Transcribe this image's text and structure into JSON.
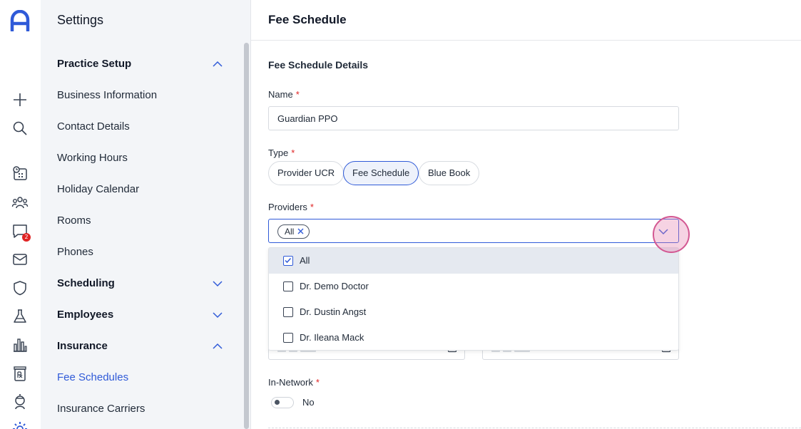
{
  "sidebar_nav": {
    "title": "Settings",
    "items": [
      {
        "label": "Practice Setup",
        "group": true,
        "expanded": true
      },
      {
        "label": "Business Information"
      },
      {
        "label": "Contact Details"
      },
      {
        "label": "Working Hours"
      },
      {
        "label": "Holiday Calendar"
      },
      {
        "label": "Rooms"
      },
      {
        "label": "Phones"
      },
      {
        "label": "Scheduling",
        "group": true,
        "expanded": false
      },
      {
        "label": "Employees",
        "group": true,
        "expanded": false
      },
      {
        "label": "Insurance",
        "group": true,
        "expanded": true
      },
      {
        "label": "Fee Schedules",
        "active": true
      },
      {
        "label": "Insurance Carriers"
      }
    ]
  },
  "rail": {
    "icons": [
      "app-logo-icon",
      "plus-icon",
      "search-icon",
      "schedule-icon",
      "patients-icon",
      "messages-icon",
      "mail-icon",
      "shield-icon",
      "lab-flask-icon",
      "reports-chart-icon",
      "prescription-icon",
      "doctor-icon",
      "settings-gear-icon"
    ],
    "messages_badge": "2"
  },
  "main": {
    "page_title": "Fee Schedule",
    "section_title": "Fee Schedule Details",
    "name": {
      "label": "Name",
      "required_mark": "*",
      "value": "Guardian PPO"
    },
    "type": {
      "label": "Type",
      "required_mark": "*",
      "options": [
        "Provider UCR",
        "Fee Schedule",
        "Blue Book"
      ],
      "selected": "Fee Schedule"
    },
    "providers": {
      "label": "Providers",
      "required_mark": "*",
      "selected_tags": [
        "All"
      ],
      "options": [
        {
          "label": "All",
          "checked": true
        },
        {
          "label": "Dr. Demo Doctor",
          "checked": false
        },
        {
          "label": "Dr. Dustin Angst",
          "checked": false
        },
        {
          "label": "Dr. Ileana Mack",
          "checked": false
        }
      ]
    },
    "in_network": {
      "label": "In-Network",
      "required_mark": "*",
      "value_label": "No",
      "on": false
    }
  },
  "colors": {
    "accent": "#2f5ad8",
    "required": "#e02424",
    "nav_bg": "#f3f5f8",
    "highlight_row": "#e5e9f0"
  }
}
